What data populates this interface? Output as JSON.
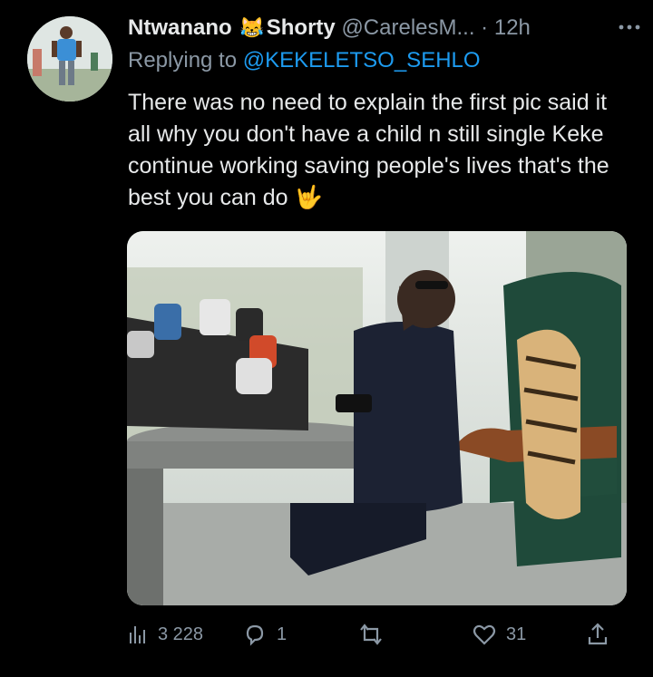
{
  "tweet": {
    "author_name": "Ntwanano",
    "author_emoji": "😹",
    "author_name_suffix": "Shorty",
    "handle": "@CarelesM...",
    "separator": "·",
    "time": "12h",
    "replying_prefix": "Replying to",
    "replying_handle": "@KEKELETSO_SEHLO",
    "text": "There was no need to explain the first pic said it all why you don't have a child n still single Keke continue working saving people's lives that's the best you can do",
    "text_emoji": "🤟",
    "more_icon": "more-icon"
  },
  "actions": {
    "views": "3 228",
    "replies": "1",
    "retweets": "",
    "likes": "31"
  },
  "colors": {
    "background": "#000000",
    "text": "#e7e9ea",
    "muted": "#8b98a5",
    "link": "#1d9bf0"
  }
}
